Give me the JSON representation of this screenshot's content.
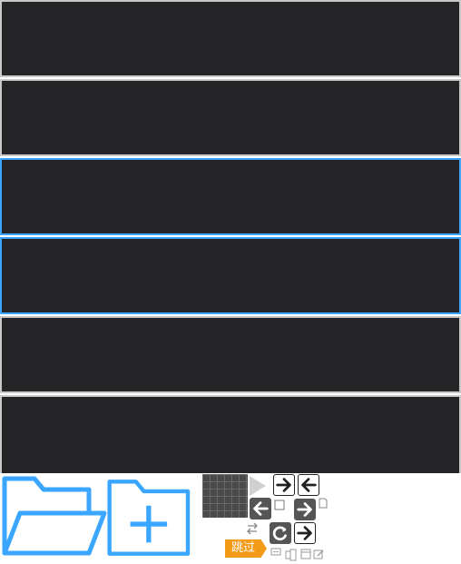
{
  "panels": [
    {
      "state": "normal"
    },
    {
      "state": "normal"
    },
    {
      "state": "selected"
    },
    {
      "state": "selected"
    },
    {
      "state": "normal"
    },
    {
      "state": "normal"
    }
  ],
  "icons": {
    "open_folder": "open-folder-icon",
    "new_folder": "new-folder-icon",
    "grid": "grid-icon",
    "play": "play-icon",
    "arrow_right": "arrow-right-icon",
    "arrow_left": "arrow-left-icon",
    "refresh": "refresh-icon",
    "swap": "swap-icon",
    "comment": "comment-icon",
    "device": "device-icon",
    "window": "window-icon",
    "edit": "edit-icon",
    "page": "page-icon"
  },
  "toolbar": {
    "skip_label": "跳过"
  },
  "colors": {
    "panel_bg": "#252527",
    "panel_border": "#c9c9c9",
    "selected_border": "#3aa6ff",
    "accent_blue": "#3aa6ff",
    "skip_orange": "#f39a17",
    "grid_dark": "#4a4a4a"
  }
}
